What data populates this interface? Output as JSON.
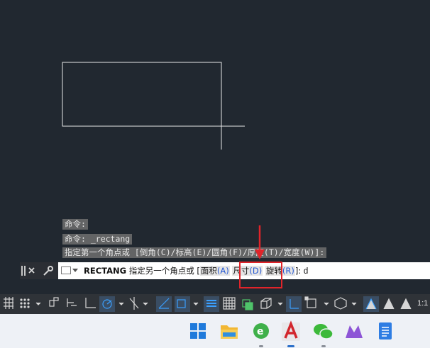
{
  "history": [
    {
      "text": "命令:"
    },
    {
      "text": "命令: _rectang"
    },
    {
      "text": "指定第一个角点或 [倒角(C)/标高(E)/圆角(F)/厚度(T)/宽度(W)]:"
    }
  ],
  "command": {
    "name": "RECTANG",
    "prompt": "指定另一个角点或 [",
    "opt_area": "面积",
    "opt_area_key": "(A)",
    "opt_size": "尺寸",
    "opt_size_key": "(D)",
    "opt_rotate": "旋转",
    "opt_rotate_key": "(R)",
    "suffix": "]:",
    "typed": "d"
  },
  "statusbar": {
    "scale_label": "1:1"
  },
  "colors": {
    "canvas_bg": "#212830",
    "annotation": "#e0242a",
    "option_key": "#2458d4"
  },
  "taskbar": {
    "apps": [
      "windows-start-icon",
      "file-explorer-icon",
      "browser-icon",
      "autocad-icon",
      "wechat-icon",
      "app-icon",
      "notepad-icon"
    ]
  }
}
